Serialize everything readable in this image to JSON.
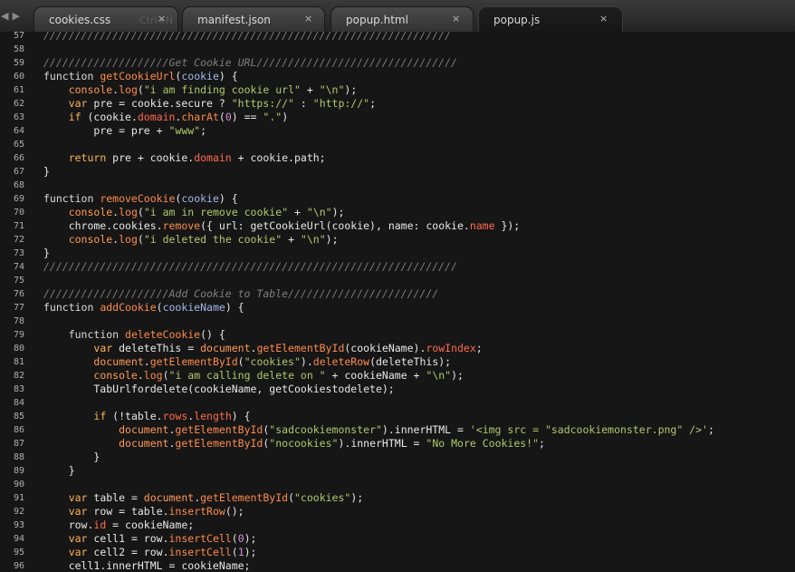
{
  "tabs": [
    {
      "label": "cookies.css",
      "active": false
    },
    {
      "label": "manifest.json",
      "active": false
    },
    {
      "label": "popup.html",
      "active": false
    },
    {
      "label": "popup.js",
      "active": true
    }
  ],
  "ghost_label": "Ctrl+N",
  "close_glyph": "×",
  "nav": {
    "back": "◀",
    "forward": "▶"
  },
  "colors": {
    "background": "#161616",
    "keyword": "#ffb454",
    "function_name": "#ff8b4a",
    "string": "#b2c86a",
    "property": "#ff6a4d",
    "number": "#d68cd8",
    "parameter": "#a5b6e8",
    "comment": "#7e7e7e"
  },
  "lines": [
    {
      "n": "57",
      "tokens": [
        [
          "cm",
          "/////////////////////////////////////////////////////////////////"
        ]
      ]
    },
    {
      "n": "58",
      "tokens": []
    },
    {
      "n": "59",
      "tokens": [
        [
          "cm",
          "////////////////////Get Cookie URL////////////////////////////////"
        ]
      ]
    },
    {
      "n": "60",
      "tokens": [
        [
          "def",
          "function "
        ],
        [
          "fn",
          "getCookieUrl"
        ],
        [
          "pl",
          "("
        ],
        [
          "arg",
          "cookie"
        ],
        [
          "pl",
          ") {"
        ]
      ]
    },
    {
      "n": "61",
      "tokens": [
        [
          "pl",
          "    "
        ],
        [
          "obj",
          "console"
        ],
        [
          "pl",
          "."
        ],
        [
          "fn",
          "log"
        ],
        [
          "pl",
          "("
        ],
        [
          "str",
          "\"i am finding cookie url\""
        ],
        [
          "pl",
          " + "
        ],
        [
          "str",
          "\"\\n\""
        ],
        [
          "pl",
          ");"
        ]
      ]
    },
    {
      "n": "62",
      "tokens": [
        [
          "pl",
          "    "
        ],
        [
          "kw",
          "var"
        ],
        [
          "pl",
          " pre = cookie.secure ? "
        ],
        [
          "str",
          "\"https://\""
        ],
        [
          "pl",
          " : "
        ],
        [
          "str",
          "\"http://\""
        ],
        [
          "pl",
          ";"
        ]
      ]
    },
    {
      "n": "63",
      "tokens": [
        [
          "pl",
          "    "
        ],
        [
          "kw",
          "if"
        ],
        [
          "pl",
          " (cookie."
        ],
        [
          "prop",
          "domain"
        ],
        [
          "pl",
          "."
        ],
        [
          "fn",
          "charAt"
        ],
        [
          "pl",
          "("
        ],
        [
          "num",
          "0"
        ],
        [
          "pl",
          ") == "
        ],
        [
          "str",
          "\".\""
        ],
        [
          "pl",
          ")"
        ]
      ]
    },
    {
      "n": "64",
      "tokens": [
        [
          "pl",
          "        pre = pre + "
        ],
        [
          "str",
          "\"www\""
        ],
        [
          "pl",
          ";"
        ]
      ]
    },
    {
      "n": "65",
      "tokens": []
    },
    {
      "n": "66",
      "tokens": [
        [
          "pl",
          "    "
        ],
        [
          "kw",
          "return"
        ],
        [
          "pl",
          " pre + cookie."
        ],
        [
          "prop",
          "domain"
        ],
        [
          "pl",
          " + cookie.path;"
        ]
      ]
    },
    {
      "n": "67",
      "tokens": [
        [
          "pl",
          "}"
        ]
      ]
    },
    {
      "n": "68",
      "tokens": []
    },
    {
      "n": "69",
      "tokens": [
        [
          "def",
          "function "
        ],
        [
          "fn",
          "removeCookie"
        ],
        [
          "pl",
          "("
        ],
        [
          "arg",
          "cookie"
        ],
        [
          "pl",
          ") {"
        ]
      ]
    },
    {
      "n": "70",
      "tokens": [
        [
          "pl",
          "    "
        ],
        [
          "obj",
          "console"
        ],
        [
          "pl",
          "."
        ],
        [
          "fn",
          "log"
        ],
        [
          "pl",
          "("
        ],
        [
          "str",
          "\"i am in remove cookie\""
        ],
        [
          "pl",
          " + "
        ],
        [
          "str",
          "\"\\n\""
        ],
        [
          "pl",
          ");"
        ]
      ]
    },
    {
      "n": "71",
      "tokens": [
        [
          "pl",
          "    chrome.cookies."
        ],
        [
          "fn",
          "remove"
        ],
        [
          "pl",
          "({ url: getCookieUrl(cookie), name: cookie."
        ],
        [
          "prop",
          "name"
        ],
        [
          "pl",
          " });"
        ]
      ]
    },
    {
      "n": "72",
      "tokens": [
        [
          "pl",
          "    "
        ],
        [
          "obj",
          "console"
        ],
        [
          "pl",
          "."
        ],
        [
          "fn",
          "log"
        ],
        [
          "pl",
          "("
        ],
        [
          "str",
          "\"i deleted the cookie\""
        ],
        [
          "pl",
          " + "
        ],
        [
          "str",
          "\"\\n\""
        ],
        [
          "pl",
          ");"
        ]
      ]
    },
    {
      "n": "73",
      "tokens": [
        [
          "pl",
          "}"
        ]
      ]
    },
    {
      "n": "74",
      "tokens": [
        [
          "cm",
          "//////////////////////////////////////////////////////////////////"
        ]
      ]
    },
    {
      "n": "75",
      "tokens": []
    },
    {
      "n": "76",
      "tokens": [
        [
          "cm",
          "////////////////////Add Cookie to Table////////////////////////"
        ]
      ]
    },
    {
      "n": "77",
      "tokens": [
        [
          "def",
          "function "
        ],
        [
          "fn",
          "addCookie"
        ],
        [
          "pl",
          "("
        ],
        [
          "arg",
          "cookieName"
        ],
        [
          "pl",
          ") {"
        ]
      ]
    },
    {
      "n": "78",
      "tokens": []
    },
    {
      "n": "79",
      "tokens": [
        [
          "pl",
          "    "
        ],
        [
          "def",
          "function "
        ],
        [
          "fn",
          "deleteCookie"
        ],
        [
          "pl",
          "() {"
        ]
      ]
    },
    {
      "n": "80",
      "tokens": [
        [
          "pl",
          "        "
        ],
        [
          "kw",
          "var"
        ],
        [
          "pl",
          " deleteThis = "
        ],
        [
          "obj",
          "document"
        ],
        [
          "pl",
          "."
        ],
        [
          "fn",
          "getElementById"
        ],
        [
          "pl",
          "(cookieName)."
        ],
        [
          "prop",
          "rowIndex"
        ],
        [
          "pl",
          ";"
        ]
      ]
    },
    {
      "n": "81",
      "tokens": [
        [
          "pl",
          "        "
        ],
        [
          "obj",
          "document"
        ],
        [
          "pl",
          "."
        ],
        [
          "fn",
          "getElementById"
        ],
        [
          "pl",
          "("
        ],
        [
          "str",
          "\"cookies\""
        ],
        [
          "pl",
          ")."
        ],
        [
          "fn",
          "deleteRow"
        ],
        [
          "pl",
          "(deleteThis);"
        ]
      ]
    },
    {
      "n": "82",
      "tokens": [
        [
          "pl",
          "        "
        ],
        [
          "obj",
          "console"
        ],
        [
          "pl",
          "."
        ],
        [
          "fn",
          "log"
        ],
        [
          "pl",
          "("
        ],
        [
          "str",
          "\"i am calling delete on \""
        ],
        [
          "pl",
          " + cookieName + "
        ],
        [
          "str",
          "\"\\n\""
        ],
        [
          "pl",
          ");"
        ]
      ]
    },
    {
      "n": "83",
      "tokens": [
        [
          "pl",
          "        TabUrlfordelete(cookieName, getCookiestodelete);"
        ]
      ]
    },
    {
      "n": "84",
      "tokens": []
    },
    {
      "n": "85",
      "tokens": [
        [
          "pl",
          "        "
        ],
        [
          "kw",
          "if"
        ],
        [
          "pl",
          " (!table."
        ],
        [
          "prop",
          "rows"
        ],
        [
          "pl",
          "."
        ],
        [
          "prop",
          "length"
        ],
        [
          "pl",
          ") {"
        ]
      ]
    },
    {
      "n": "86",
      "tokens": [
        [
          "pl",
          "            "
        ],
        [
          "obj",
          "document"
        ],
        [
          "pl",
          "."
        ],
        [
          "fn",
          "getElementById"
        ],
        [
          "pl",
          "("
        ],
        [
          "str",
          "\"sadcookiemonster\""
        ],
        [
          "pl",
          ").innerHTML = "
        ],
        [
          "str",
          "'<img src = \"sadcookiemonster.png\" />'"
        ],
        [
          "pl",
          ";"
        ]
      ]
    },
    {
      "n": "87",
      "tokens": [
        [
          "pl",
          "            "
        ],
        [
          "obj",
          "document"
        ],
        [
          "pl",
          "."
        ],
        [
          "fn",
          "getElementById"
        ],
        [
          "pl",
          "("
        ],
        [
          "str",
          "\"nocookies\""
        ],
        [
          "pl",
          ").innerHTML = "
        ],
        [
          "str",
          "\"No More Cookies!\""
        ],
        [
          "pl",
          ";"
        ]
      ]
    },
    {
      "n": "88",
      "tokens": [
        [
          "pl",
          "        }"
        ]
      ]
    },
    {
      "n": "89",
      "tokens": [
        [
          "pl",
          "    }"
        ]
      ]
    },
    {
      "n": "90",
      "tokens": []
    },
    {
      "n": "91",
      "tokens": [
        [
          "pl",
          "    "
        ],
        [
          "kw",
          "var"
        ],
        [
          "pl",
          " table = "
        ],
        [
          "obj",
          "document"
        ],
        [
          "pl",
          "."
        ],
        [
          "fn",
          "getElementById"
        ],
        [
          "pl",
          "("
        ],
        [
          "str",
          "\"cookies\""
        ],
        [
          "pl",
          ");"
        ]
      ]
    },
    {
      "n": "92",
      "tokens": [
        [
          "pl",
          "    "
        ],
        [
          "kw",
          "var"
        ],
        [
          "pl",
          " row = table."
        ],
        [
          "fn",
          "insertRow"
        ],
        [
          "pl",
          "();"
        ]
      ]
    },
    {
      "n": "93",
      "tokens": [
        [
          "pl",
          "    row."
        ],
        [
          "prop",
          "id"
        ],
        [
          "pl",
          " = cookieName;"
        ]
      ]
    },
    {
      "n": "94",
      "tokens": [
        [
          "pl",
          "    "
        ],
        [
          "kw",
          "var"
        ],
        [
          "pl",
          " cell1 = row."
        ],
        [
          "fn",
          "insertCell"
        ],
        [
          "pl",
          "("
        ],
        [
          "num",
          "0"
        ],
        [
          "pl",
          ");"
        ]
      ]
    },
    {
      "n": "95",
      "tokens": [
        [
          "pl",
          "    "
        ],
        [
          "kw",
          "var"
        ],
        [
          "pl",
          " cell2 = row."
        ],
        [
          "fn",
          "insertCell"
        ],
        [
          "pl",
          "("
        ],
        [
          "num",
          "1"
        ],
        [
          "pl",
          ");"
        ]
      ]
    },
    {
      "n": "96",
      "tokens": [
        [
          "pl",
          "    cell1.innerHTML = cookieName;"
        ]
      ]
    }
  ]
}
